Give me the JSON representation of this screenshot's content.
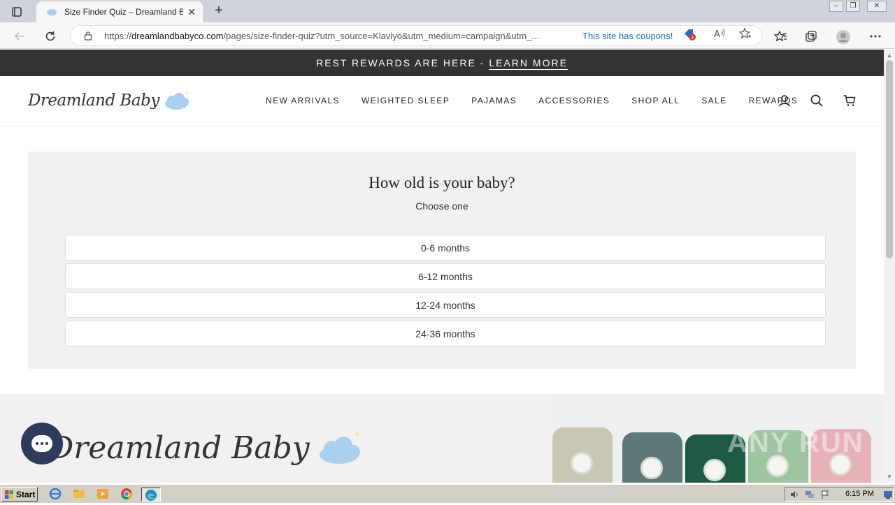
{
  "browser": {
    "tab_title": "Size Finder Quiz – Dreamland B",
    "url_domain": "dreamlandbabyco.com",
    "url_prefix": "https://",
    "url_rest": "/pages/size-finder-quiz?utm_source=Klaviyo&utm_medium=campaign&utm_...",
    "coupons_text": "This site has coupons!",
    "coupon_badge_count": "3"
  },
  "announcement": {
    "text": "REST REWARDS ARE HERE -",
    "link": "LEARN MORE"
  },
  "header": {
    "logo_text": "Dreamland Baby",
    "nav": [
      "NEW ARRIVALS",
      "WEIGHTED SLEEP",
      "PAJAMAS",
      "ACCESSORIES",
      "SHOP ALL",
      "SALE",
      "REWARDS"
    ]
  },
  "quiz": {
    "question": "How old is your baby?",
    "subtitle": "Choose one",
    "options": [
      "0-6 months",
      "6-12 months",
      "12-24 months",
      "24-36 months"
    ]
  },
  "footer_banner": {
    "logo_text": "Dreamland Baby"
  },
  "taskbar": {
    "start_label": "Start",
    "clock": "6:15 PM"
  },
  "watermark": "ANY RUN",
  "colors": {
    "announcement_bg": "#333333",
    "quiz_bg": "#f3f1ef",
    "cloud_blue": "#a9d0ee",
    "chat_bg": "#2e3b5c"
  }
}
